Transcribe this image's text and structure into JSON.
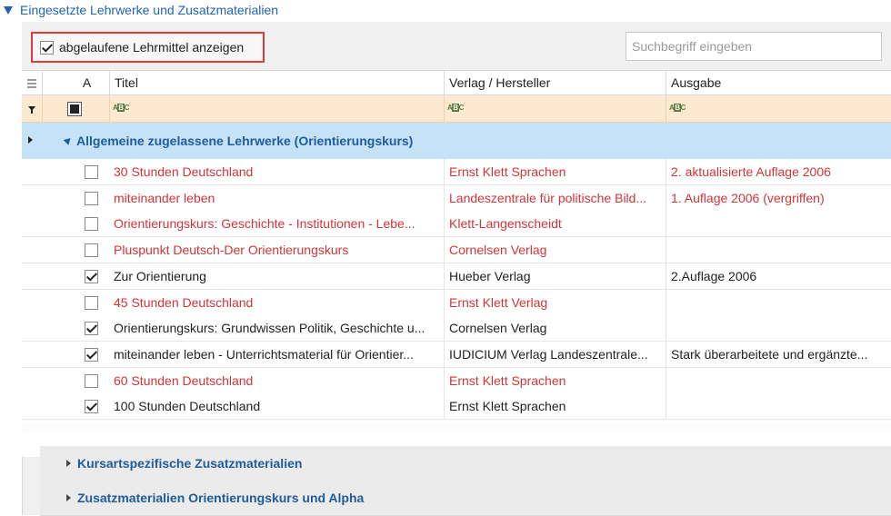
{
  "section": {
    "title": "Eingesetzte Lehrwerke und Zusatzmaterialien"
  },
  "toolbar": {
    "show_expired_label": "abgelaufene Lehrmittel anzeigen",
    "show_expired_checked": true,
    "search_placeholder": "Suchbegriff eingeben"
  },
  "grid": {
    "columns": {
      "a": "A",
      "title": "Titel",
      "publisher": "Verlag / Hersteller",
      "edition": "Ausgabe"
    },
    "group": {
      "label": "Allgemeine zugelassene Lehrwerke (Orientierungskurs)"
    },
    "rows": [
      {
        "checked": false,
        "expired": true,
        "title": "30 Stunden Deutschland",
        "publisher": "Ernst Klett Sprachen",
        "edition": "2. aktualisierte Auflage 2006"
      },
      {
        "checked": false,
        "expired": true,
        "title": "miteinander leben",
        "publisher": "Landeszentrale für politische Bild...",
        "edition": "1. Auflage 2006 (vergriffen)"
      },
      {
        "checked": false,
        "expired": true,
        "title": "Orientierungskurs: Geschichte - Institutionen - Lebe...",
        "publisher": "Klett-Langenscheidt",
        "edition": ""
      },
      {
        "checked": false,
        "expired": true,
        "title": "Pluspunkt Deutsch-Der Orientierungskurs",
        "publisher": "Cornelsen Verlag",
        "edition": ""
      },
      {
        "checked": true,
        "expired": false,
        "title": "Zur Orientierung",
        "publisher": "Hueber Verlag",
        "edition": "2.Auflage 2006"
      },
      {
        "checked": false,
        "expired": true,
        "title": "45 Stunden Deutschland",
        "publisher": "Ernst Klett Verlag",
        "edition": ""
      },
      {
        "checked": true,
        "expired": false,
        "title": "Orientierungskurs: Grundwissen Politik, Geschichte u...",
        "publisher": "Cornelsen Verlag",
        "edition": ""
      },
      {
        "checked": true,
        "expired": false,
        "title": "miteinander leben - Unterrichtsmaterial für Orientier...",
        "publisher": "IUDICIUM Verlag Landeszentrale...",
        "edition": "Stark überarbeitete und ergänzte..."
      },
      {
        "checked": false,
        "expired": true,
        "title": "60 Stunden Deutschland",
        "publisher": "Ernst Klett Sprachen",
        "edition": ""
      },
      {
        "checked": true,
        "expired": false,
        "title": "100 Stunden Deutschland",
        "publisher": "Ernst Klett Sprachen",
        "edition": ""
      }
    ]
  },
  "subgroups": [
    {
      "label": "Kursartspezifische Zusatzmaterialien"
    },
    {
      "label": "Zusatzmaterialien Orientierungskurs und Alpha"
    }
  ]
}
